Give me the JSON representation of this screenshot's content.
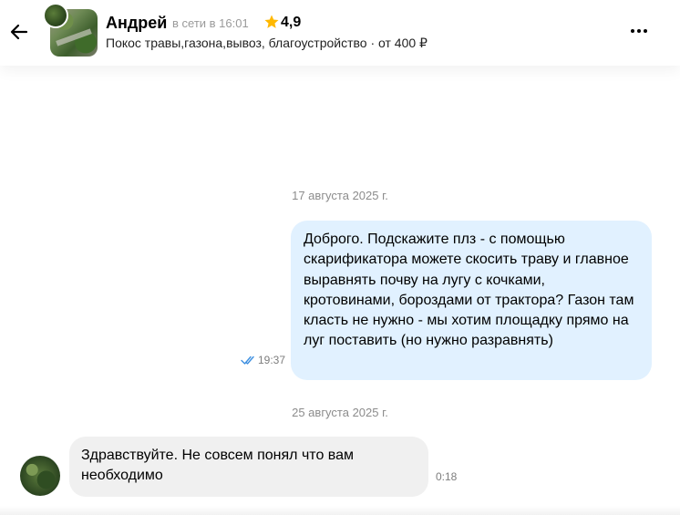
{
  "header": {
    "back_icon": "arrow-left-icon",
    "seller_name": "Андрей",
    "online_status": "в сети в 16:01",
    "rating": "4,9",
    "rating_icon": "star-icon",
    "rating_color": "#FFB800",
    "ad_title": "Покос травы,газона,вывоз, благоустройство · от 400 ₽",
    "more_icon": "more-horizontal-icon"
  },
  "messages": [
    {
      "date": "17 августа 2025 г.",
      "direction": "outgoing",
      "text": "Доброго. Подскажите плз - с помощью скарификатора можете скосить траву и главное выравнять почву на лугу с кочками, кротовинами, бороздами от трактора? Газон там класть не нужно - мы хотим площадку прямо на луг поставить (но нужно разравнять)",
      "time": "19:37",
      "status_icon": "double-check-icon",
      "bubble_color": "#E1F1FF"
    },
    {
      "date": "25 августа 2025 г.",
      "direction": "incoming",
      "text": "Здравствуйте. Не совсем понял что вам необходимо",
      "time": "0:18",
      "bubble_color": "#F0F0F0"
    }
  ]
}
